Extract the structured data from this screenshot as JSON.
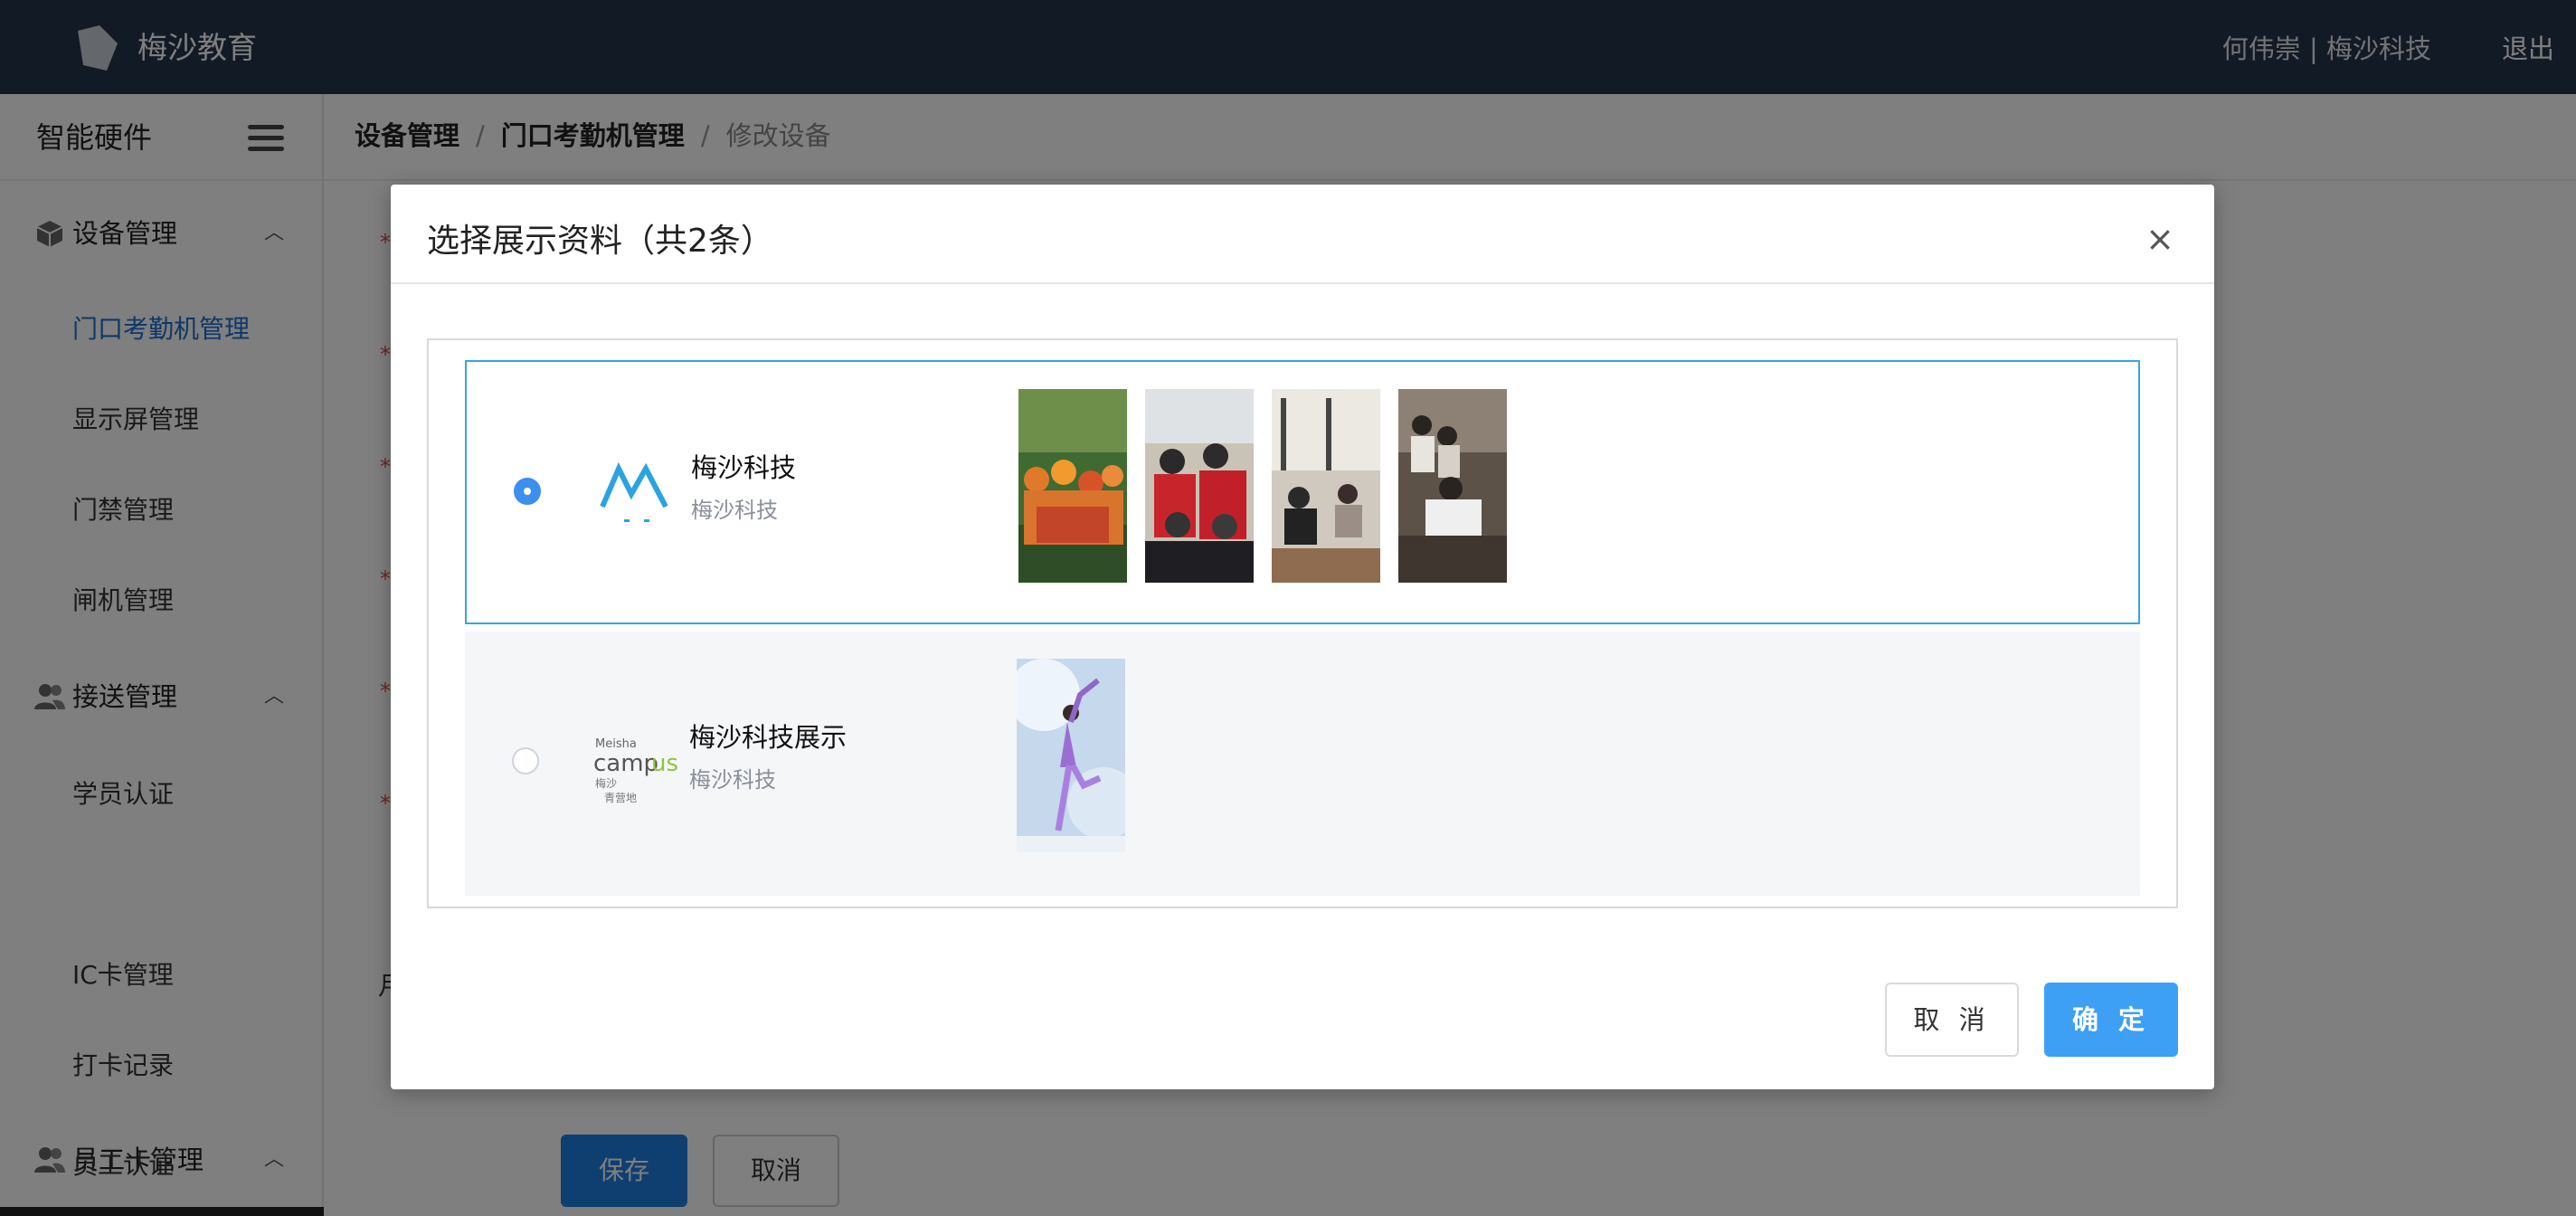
{
  "topbar": {
    "brand": "梅沙教育",
    "user": "何伟崇 | 梅沙科技",
    "logout": "退出"
  },
  "sidebar": {
    "title": "智能硬件",
    "groups": [
      {
        "label": "设备管理",
        "icon": "cube-icon",
        "items": [
          "门口考勤机管理",
          "显示屏管理",
          "门禁管理",
          "闸机管理"
        ]
      },
      {
        "label": "接送管理",
        "icon": "people-icon",
        "items": [
          "学员认证",
          "IC卡管理",
          "打卡记录"
        ]
      },
      {
        "label": "员工卡管理",
        "icon": "people-icon",
        "items": [
          "员工认证"
        ]
      }
    ],
    "active_item": "门口考勤机管理"
  },
  "breadcrumb": {
    "items": [
      "设备管理",
      "门口考勤机管理",
      "修改设备"
    ]
  },
  "main": {
    "label_fragment": "月",
    "save": "保存",
    "cancel": "取消"
  },
  "modal": {
    "title": "选择展示资料（共2条）",
    "close": "×",
    "cards": [
      {
        "name": "梅沙科技",
        "subtitle": "梅沙科技",
        "selected": true,
        "logo": "meisha-mountain-logo",
        "thumbnails": [
          "group-hiking-photo",
          "group-cheering-photo",
          "meeting-room-photo",
          "team-photo"
        ]
      },
      {
        "name": "梅沙科技展示",
        "subtitle": "梅沙科技",
        "selected": false,
        "logo": "meisha-campus-logo",
        "logo_text": [
          "Meisha",
          "campus",
          "梅沙",
          "青营地"
        ],
        "thumbnails": [
          "dancer-photo"
        ]
      }
    ],
    "cancel": "取 消",
    "ok": "确 定"
  },
  "colors": {
    "topbar": "#24354c",
    "accent": "#3da0f5",
    "selected_border": "#35a6e6",
    "active_link": "#1f6fd1"
  }
}
